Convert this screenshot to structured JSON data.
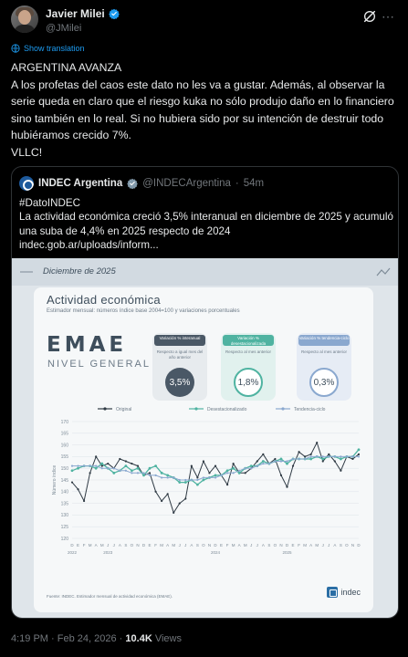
{
  "author": {
    "name": "Javier Milei",
    "handle": "@JMilei"
  },
  "translate_label": "Show translation",
  "tweet_paragraphs": [
    "ARGENTINA AVANZA",
    "A los profetas del caos este dato no les va a gustar. Además, al observar la serie queda en claro que el riesgo kuka no sólo produjo daño en lo financiero sino también en lo real. Si no hubiera sido por su intención de destruir todo hubiéramos crecido 7%.",
    "VLLC!"
  ],
  "quote": {
    "name": "INDEC Argentina",
    "handle": "@INDECArgentina",
    "dot": "·",
    "time": "54m",
    "lines": [
      "#DatoINDEC",
      "La actividad económica creció 3,5% interanual en diciembre de 2025 y acumuló una suba de 4,4% en 2025 respecto de 2024",
      "indec.gob.ar/uploads/inform..."
    ]
  },
  "infographic": {
    "month": "Diciembre de 2025",
    "title": "Actividad económica",
    "subtitle": "Estimador mensual: números índice base 2004=100 y variaciones porcentuales",
    "emae": "EMAE",
    "emae_sub": "NIVEL GENERAL",
    "stats": [
      {
        "tag": "Variación % interanual",
        "desc": "Respecto a igual mes del año anterior",
        "value": "3,5%",
        "color": "#4a5866"
      },
      {
        "tag": "Variación % desestacionalizada",
        "desc": "Respecto al mes anterior",
        "value": "1,8%",
        "color": "#4fb3a1"
      },
      {
        "tag": "Variación % tendencia-ciclo",
        "desc": "Respecto al mes anterior",
        "value": "0,3%",
        "color": "#8aa8cf"
      }
    ],
    "source": "Fuente: INDEC. Estimador mensual de actividad económica (EMAE).",
    "logo": "indec",
    "colors": {
      "original": "#2f3a44",
      "desestacionalizado": "#4fb3a1",
      "tendencia": "#8aa8cf"
    }
  },
  "chart_data": {
    "type": "line",
    "ylabel": "Número índice",
    "ylim": [
      120,
      170
    ],
    "yticks": [
      120,
      125,
      130,
      135,
      140,
      145,
      150,
      155,
      160,
      165,
      170
    ],
    "months": [
      "D",
      "E",
      "F",
      "M",
      "A",
      "M",
      "J",
      "J",
      "A",
      "S",
      "O",
      "N",
      "D",
      "E",
      "F",
      "M",
      "A",
      "M",
      "J",
      "J",
      "A",
      "S",
      "O",
      "N",
      "D",
      "E",
      "F",
      "M",
      "A",
      "M",
      "J",
      "J",
      "A",
      "S",
      "O",
      "N",
      "D",
      "E",
      "F",
      "M",
      "A",
      "M",
      "J",
      "J",
      "A",
      "S",
      "O",
      "N",
      "D"
    ],
    "years": [
      {
        "label": "2022",
        "index": 0
      },
      {
        "label": "2023",
        "index": 6
      },
      {
        "label": "2024",
        "index": 24
      },
      {
        "label": "2025",
        "index": 36
      }
    ],
    "series": [
      {
        "name": "Original",
        "values": [
          144,
          141,
          136,
          148,
          155,
          151,
          152,
          150,
          154,
          153,
          152,
          151,
          147,
          148,
          140,
          136,
          139,
          131,
          135,
          137,
          151,
          146,
          153,
          148,
          151,
          147,
          143,
          152,
          148,
          148,
          150,
          153,
          156,
          152,
          154,
          147,
          142,
          151,
          157,
          155,
          156,
          161,
          153,
          156,
          153,
          149,
          155,
          154,
          156
        ]
      },
      {
        "name": "Desestacionalizado",
        "values": [
          149,
          150,
          151,
          151,
          150,
          152,
          150,
          148,
          149,
          151,
          149,
          150,
          147,
          150,
          151,
          148,
          147,
          146,
          144,
          144,
          145,
          143,
          145,
          146,
          147,
          147,
          149,
          150,
          148,
          150,
          151,
          151,
          153,
          152,
          153,
          154,
          152,
          154,
          154,
          154,
          154,
          155,
          154,
          155,
          155,
          154,
          155,
          155,
          158
        ]
      },
      {
        "name": "Tendencia-ciclo",
        "values": [
          151,
          151,
          151,
          151,
          151,
          150,
          150,
          150,
          149,
          149,
          148,
          148,
          148,
          147,
          147,
          146,
          146,
          146,
          145,
          145,
          145,
          145,
          146,
          146,
          146,
          147,
          148,
          148,
          149,
          150,
          150,
          151,
          152,
          152,
          153,
          153,
          153,
          154,
          154,
          154,
          155,
          155,
          155,
          155,
          155,
          155,
          155,
          155,
          155
        ]
      }
    ]
  },
  "meta": {
    "time": "4:19 PM",
    "dot": "·",
    "date": "Feb 24, 2026",
    "dot2": "·",
    "views": "10.4K",
    "views_label": "Views"
  }
}
